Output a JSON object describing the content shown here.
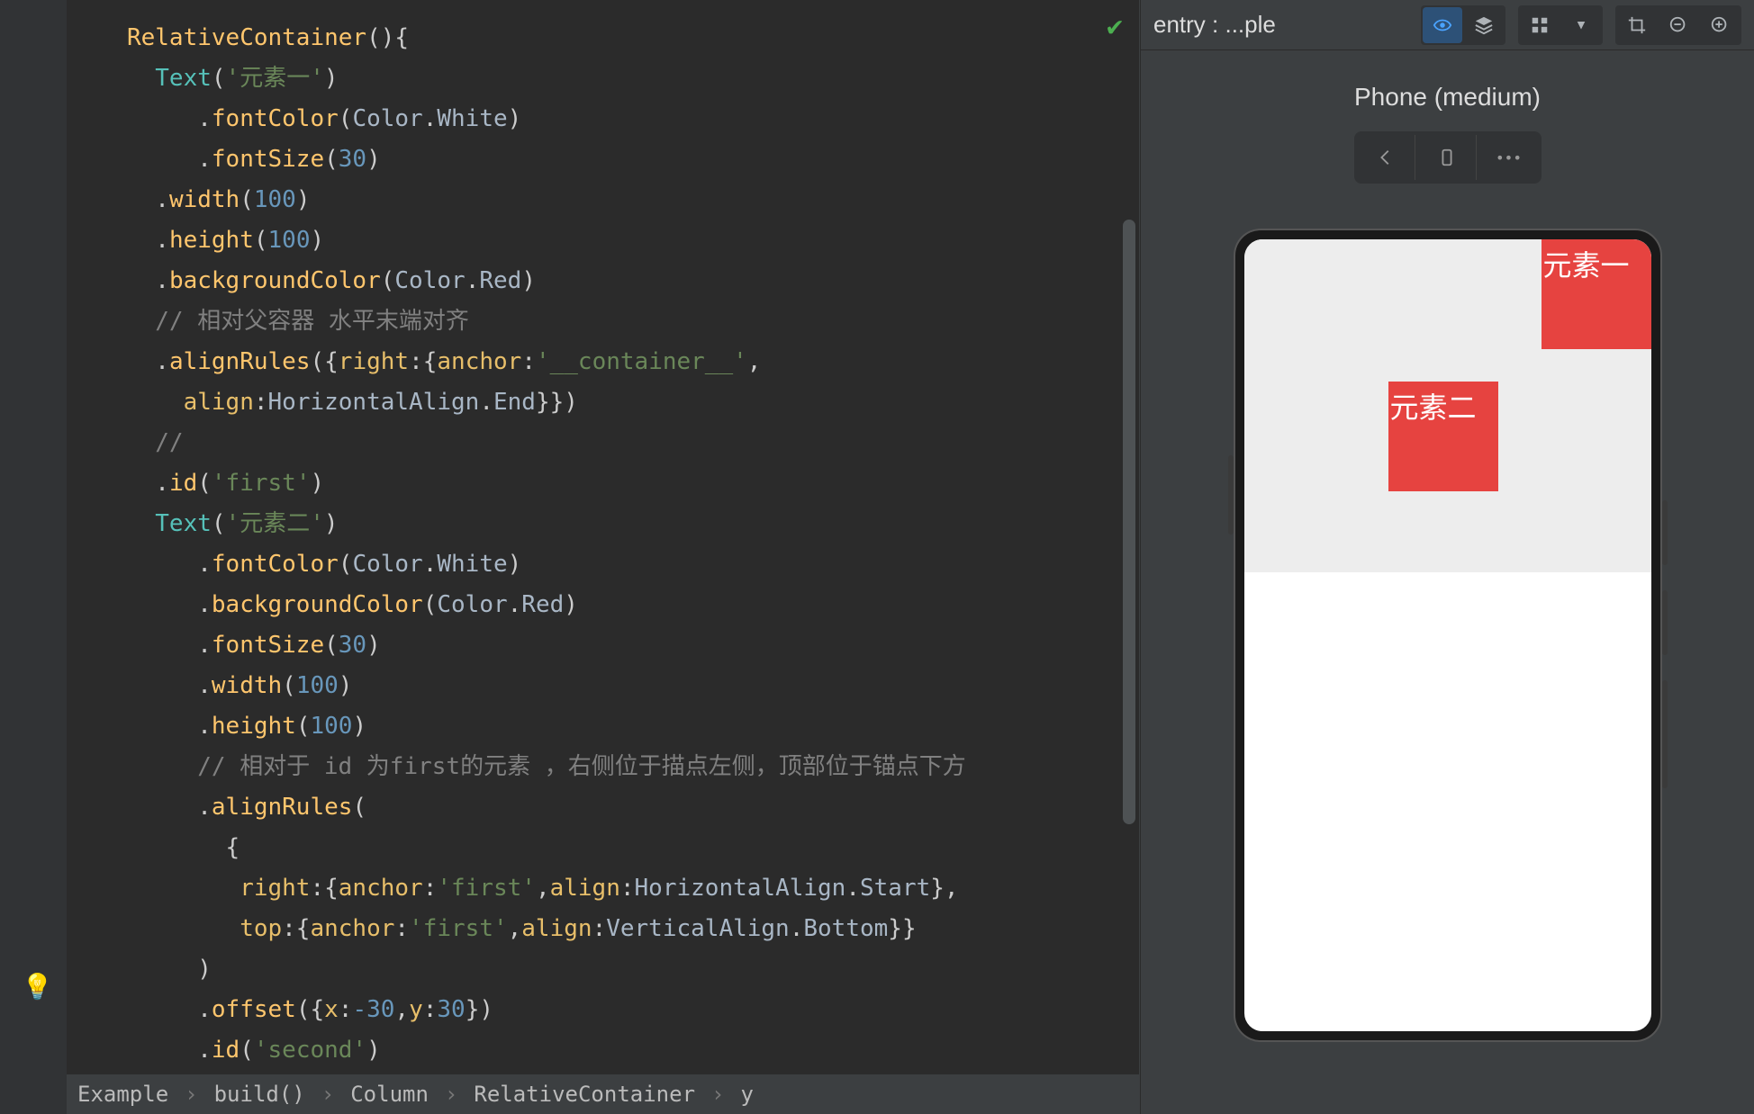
{
  "breadcrumbs": [
    "Example",
    "build()",
    "Column",
    "RelativeContainer",
    "y"
  ],
  "preview": {
    "tab_title": "entry : ...ple",
    "device_label": "Phone (medium)",
    "element1_text": "元素一",
    "element2_text": "元素二"
  },
  "code": {
    "l1_fn": "RelativeContainer",
    "l1_after": "(){",
    "l2_fn": "Text",
    "l2_open": "(",
    "l2_str": "'元素一'",
    "l2_close": ")",
    "l3_dot": ".",
    "l3_m": "fontColor",
    "l3_o": "(",
    "l3_a": "Color",
    "l3_d": ".",
    "l3_b": "White",
    "l3_c": ")",
    "l4_dot": ".",
    "l4_m": "fontSize",
    "l4_o": "(",
    "l4_n": "30",
    "l4_c": ")",
    "l5_dot": ".",
    "l5_m": "width",
    "l5_o": "(",
    "l5_n": "100",
    "l5_c": ")",
    "l6_dot": ".",
    "l6_m": "height",
    "l6_o": "(",
    "l6_n": "100",
    "l6_c": ")",
    "l7_dot": ".",
    "l7_m": "backgroundColor",
    "l7_o": "(",
    "l7_a": "Color",
    "l7_d": ".",
    "l7_b": "Red",
    "l7_c": ")",
    "l8_cmt": "// 相对父容器 水平末端对齐",
    "l9_dot": ".",
    "l9_m": "alignRules",
    "l9_o": "({",
    "l9_k1": "right",
    "l9_s1": ":{",
    "l9_k2": "anchor",
    "l9_s2": ":",
    "l9_str": "'__container__'",
    "l9_s3": ",",
    "l10_k": "align",
    "l10_s1": ":",
    "l10_a": "HorizontalAlign",
    "l10_d": ".",
    "l10_b": "End",
    "l10_c": "}})",
    "l11_cmt": "//",
    "l12_dot": ".",
    "l12_m": "id",
    "l12_o": "(",
    "l12_str": "'first'",
    "l12_c": ")",
    "l13_fn": "Text",
    "l13_o": "(",
    "l13_str": "'元素二'",
    "l13_c": ")",
    "l14_dot": ".",
    "l14_m": "fontColor",
    "l14_o": "(",
    "l14_a": "Color",
    "l14_d": ".",
    "l14_b": "White",
    "l14_c": ")",
    "l15_dot": ".",
    "l15_m": "backgroundColor",
    "l15_o": "(",
    "l15_a": "Color",
    "l15_d": ".",
    "l15_b": "Red",
    "l15_c": ")",
    "l16_dot": ".",
    "l16_m": "fontSize",
    "l16_o": "(",
    "l16_n": "30",
    "l16_c": ")",
    "l17_dot": ".",
    "l17_m": "width",
    "l17_o": "(",
    "l17_n": "100",
    "l17_c": ")",
    "l18_dot": ".",
    "l18_m": "height",
    "l18_o": "(",
    "l18_n": "100",
    "l18_c": ")",
    "l19_cmt": "// 相对于 id 为first的元素 ，右侧位于描点左侧，顶部位于锚点下方",
    "l20_dot": ".",
    "l20_m": "alignRules",
    "l20_o": "(",
    "l21_o": "{",
    "l22_k": "right",
    "l22_s1": ":{",
    "l22_k2": "anchor",
    "l22_s2": ":",
    "l22_str": "'first'",
    "l22_s3": ",",
    "l22_k3": "align",
    "l22_s4": ":",
    "l22_a": "HorizontalAlign",
    "l22_d": ".",
    "l22_b": "Start",
    "l22_c": "},",
    "l23_k": "top",
    "l23_s1": ":{",
    "l23_k2": "anchor",
    "l23_s2": ":",
    "l23_str": "'first'",
    "l23_s3": ",",
    "l23_k3": "align",
    "l23_s4": ":",
    "l23_a": "VerticalAlign",
    "l23_d": ".",
    "l23_b": "Bottom",
    "l23_c": "}}",
    "l24_c": ")",
    "l25_dot": ".",
    "l25_m": "offset",
    "l25_o": "({",
    "l25_k1": "x",
    "l25_s1": ":",
    "l25_n1": "-30",
    "l25_s2": ",",
    "l25_k2": "y",
    "l25_s3": ":",
    "l25_n2": "30",
    "l25_c": "})",
    "l26_dot": ".",
    "l26_m": "id",
    "l26_o": "(",
    "l26_str": "'second'",
    "l26_c": ")",
    "l27_c": "}"
  }
}
